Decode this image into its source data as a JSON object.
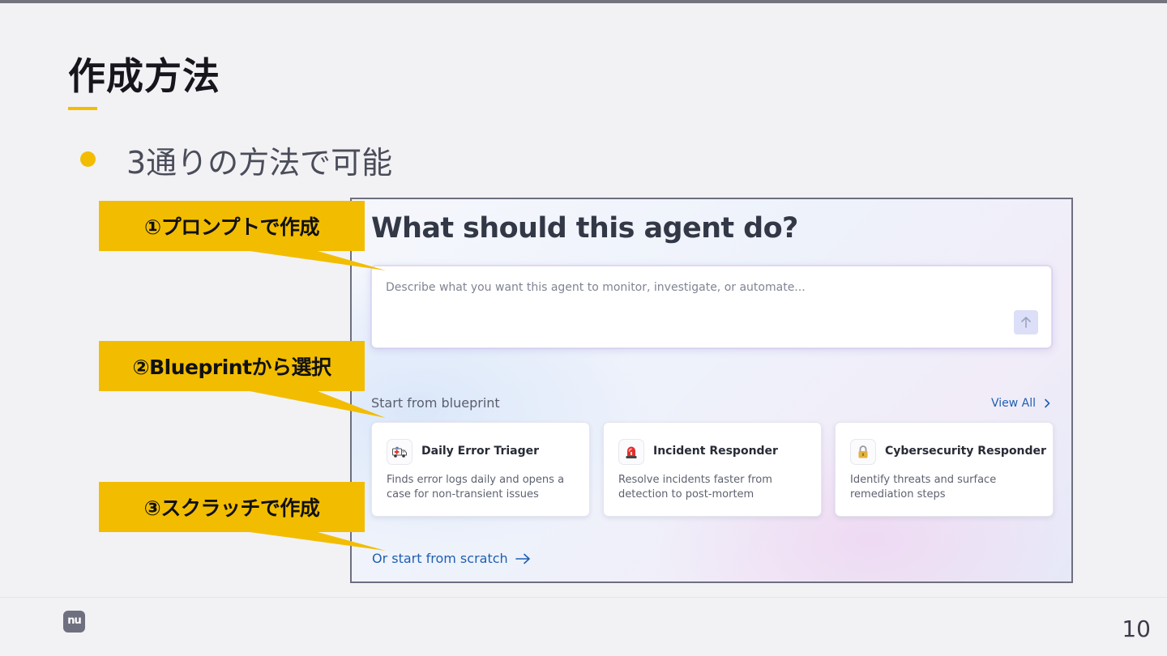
{
  "slide": {
    "title": "作成方法",
    "bullet": "3通りの方法で可能",
    "page_number": "10",
    "logo_text": "nu",
    "accent_color": "#f2bd00"
  },
  "screenshot": {
    "heading": "What should this agent do?",
    "prompt_placeholder": "Describe what you want this agent to monitor, investigate, or automate...",
    "send_icon": "arrow-up-icon",
    "blueprint_label": "Start from blueprint",
    "view_all": "View All",
    "cards": [
      {
        "icon": "ambulance-icon",
        "title": "Daily Error Triager",
        "description": "Finds error logs daily and opens a case for non-transient issues"
      },
      {
        "icon": "siren-icon",
        "title": "Incident Responder",
        "description": "Resolve incidents faster from detection to post-mortem"
      },
      {
        "icon": "lock-icon",
        "title": "Cybersecurity Responder",
        "description": "Identify threats and surface remediation steps"
      }
    ],
    "scratch_link": "Or start from scratch",
    "link_color": "#1e5fb2"
  },
  "callouts": [
    {
      "label": "①プロンプトで作成"
    },
    {
      "label": "②Blueprintから選択"
    },
    {
      "label": "③スクラッチで作成"
    }
  ]
}
